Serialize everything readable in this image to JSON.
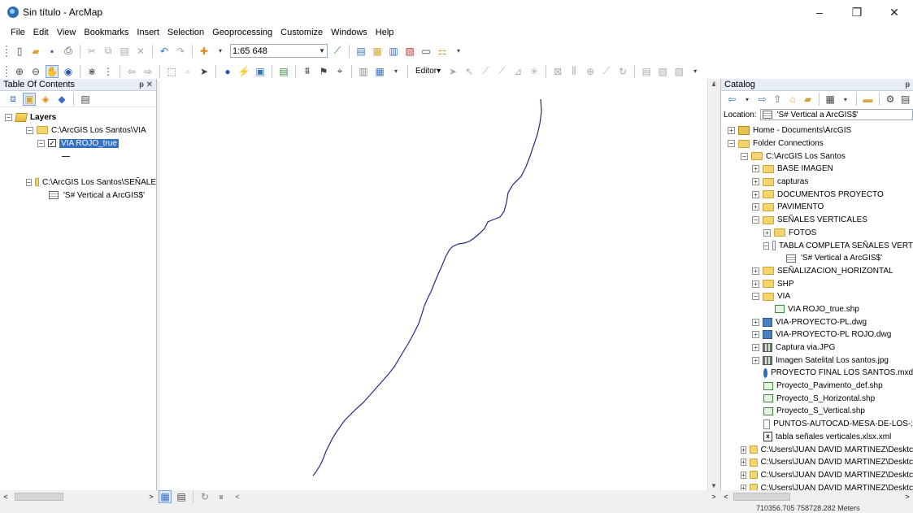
{
  "window": {
    "title": "Sin título - ArcMap",
    "minimize_glyph": "–",
    "maximize_glyph": "❐",
    "close_glyph": "✕"
  },
  "menu": [
    "File",
    "Edit",
    "View",
    "Bookmarks",
    "Insert",
    "Selection",
    "Geoprocessing",
    "Customize",
    "Windows",
    "Help"
  ],
  "toolbar": {
    "scale": "1:65 648",
    "editor_label": "Editor▾"
  },
  "toc": {
    "title": "Table Of Contents",
    "pin": "ᵽ ✕",
    "root": "Layers",
    "group1_path": "C:\\ArcGIS Los Santos\\VIA",
    "layer1": "VIA ROJO_true",
    "group2_path": "C:\\ArcGIS Los Santos\\SEÑALE",
    "table1": "'S# Vertical a ArcGIS$'"
  },
  "catalog": {
    "title": "Catalog",
    "pin": "ᵽ",
    "location_label": "Location:",
    "location_value": "'S# Vertical a ArcGIS$'",
    "items": [
      "Home - Documents\\ArcGIS",
      "Folder Connections",
      "C:\\ArcGIS Los Santos",
      "BASE IMAGEN",
      "capturas",
      "DOCUMENTOS PROYECTO",
      "PAVIMENTO",
      "SEÑALES VERTICALES",
      "FOTOS",
      "TABLA COMPLETA SEÑALES VERT",
      "'S# Vertical a ArcGIS$'",
      "SEÑALIZACION_HORIZONTAL",
      "SHP",
      "VIA",
      "VIA ROJO_true.shp",
      "VIA-PROYECTO-PL.dwg",
      "VIA-PROYECTO-PL ROJO.dwg",
      "Captura via.JPG",
      "Imagen Satelital Los santos.jpg",
      "PROYECTO FINAL LOS SANTOS.mxd",
      "Proyecto_Pavimento_def.shp",
      "Proyecto_S_Horizontal.shp",
      "Proyecto_S_Vertical.shp",
      "PUNTOS-AUTOCAD-MESA-DE-LOS-:",
      "tabla señales verticales.xlsx.xml",
      "C:\\Users\\JUAN DAVID MARTINEZ\\Desktc",
      "C:\\Users\\JUAN DAVID MARTINEZ\\Desktc",
      "C:\\Users\\JUAN DAVID MARTINEZ\\Desktc",
      "C:\\Users\\JUAN DAVID MARTINEZ\\Desktc"
    ]
  },
  "status": {
    "coordinates": "710356.705  758728.282 Meters"
  },
  "colors": {
    "road_line": "#1f2a8c",
    "selection": "#3372c4"
  }
}
